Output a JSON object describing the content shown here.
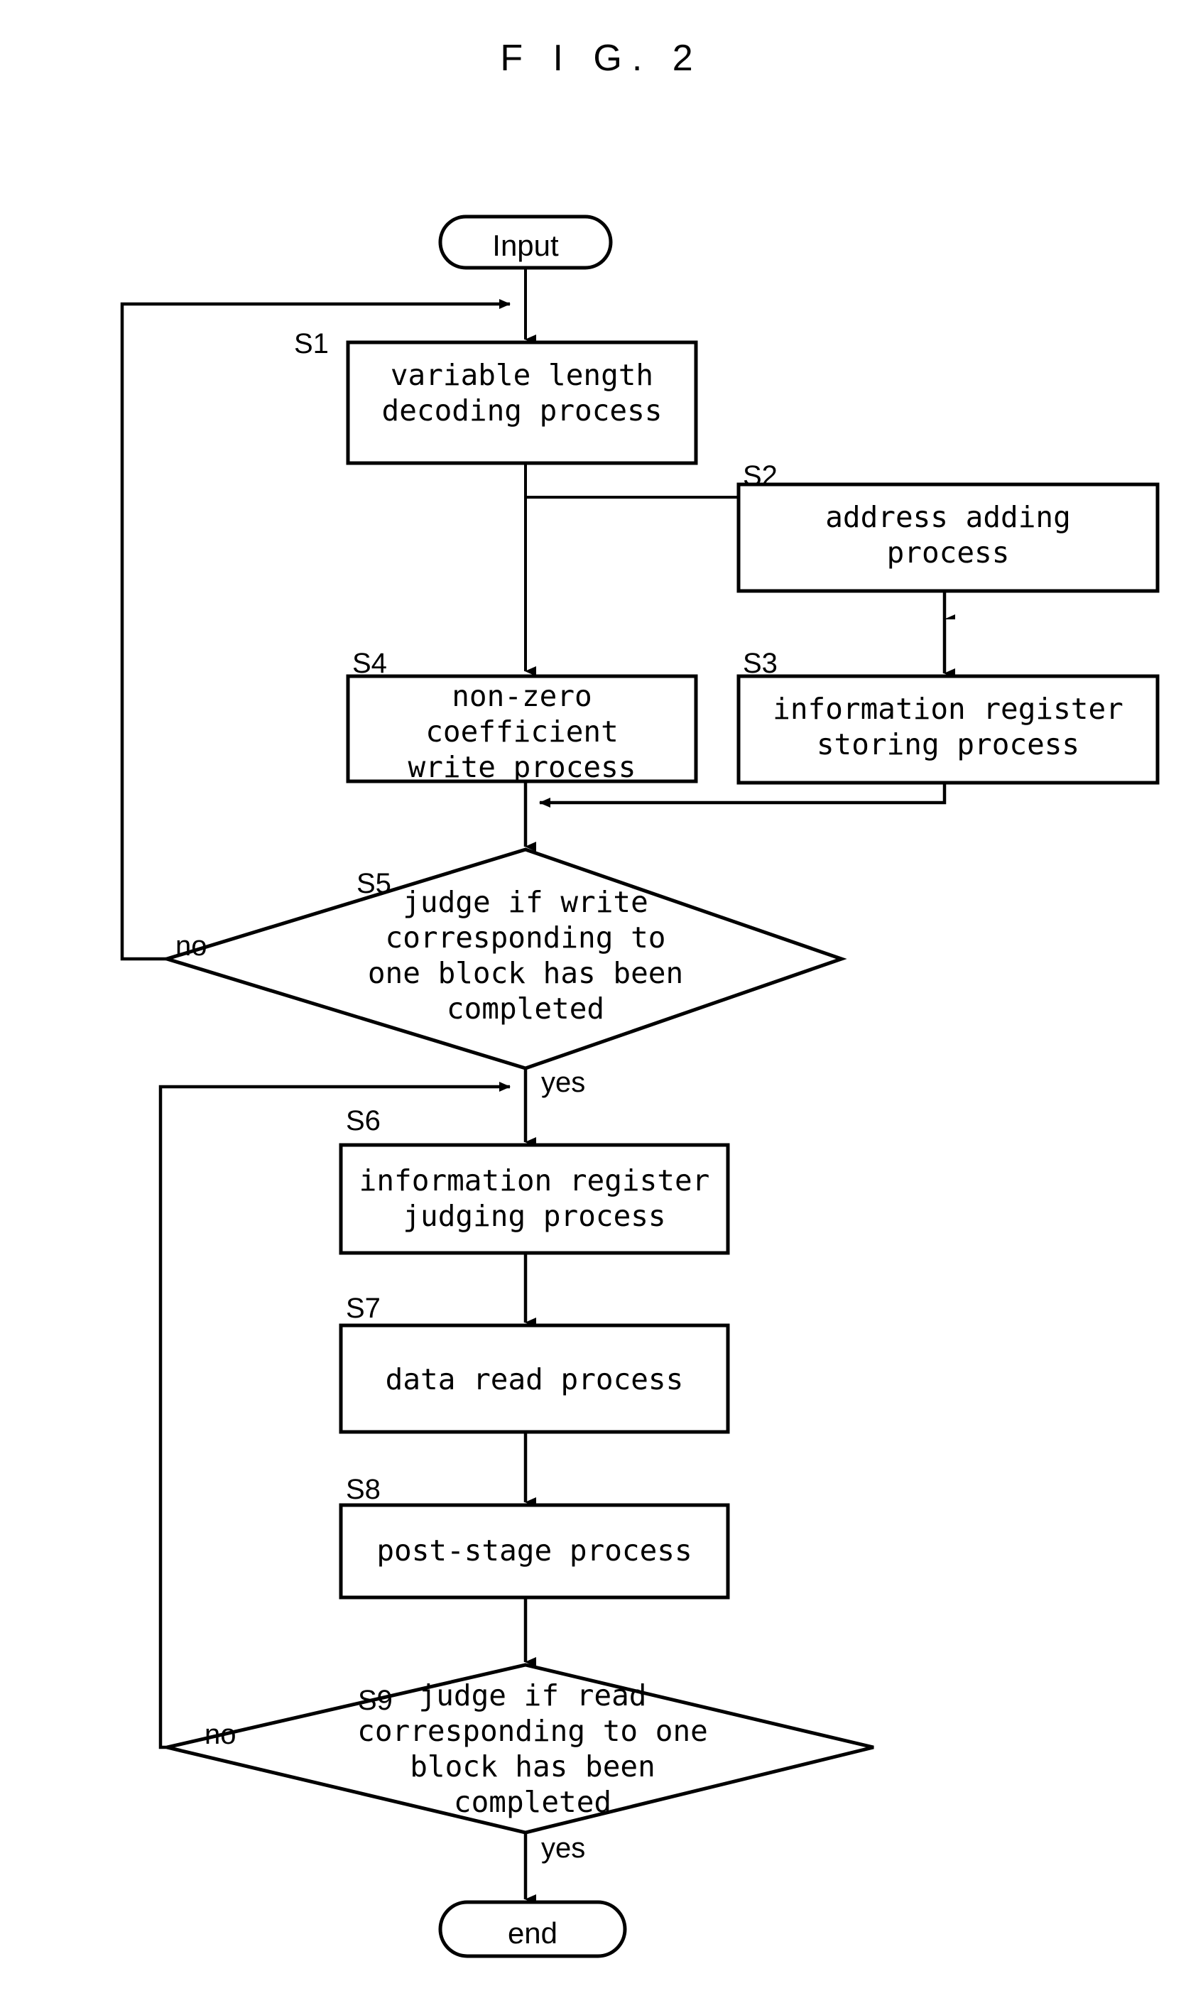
{
  "figure": {
    "title": "F I G. 2",
    "type": "flowchart"
  },
  "nodes": {
    "input": {
      "id": "Input",
      "shape": "terminal",
      "text": "Input"
    },
    "s1": {
      "id": "S1",
      "shape": "process",
      "text": "variable length\ndecoding process"
    },
    "s2": {
      "id": "S2",
      "shape": "process",
      "text": "address adding\nprocess"
    },
    "s3": {
      "id": "S3",
      "shape": "process",
      "text": "information register\nstoring process"
    },
    "s4": {
      "id": "S4",
      "shape": "process",
      "text": "non-zero\ncoefficient\nwrite process"
    },
    "s5": {
      "id": "S5",
      "shape": "decision",
      "text": "judge if write\ncorresponding to\none block has been\ncompleted"
    },
    "s6": {
      "id": "S6",
      "shape": "process",
      "text": "information register\njudging process"
    },
    "s7": {
      "id": "S7",
      "shape": "process",
      "text": "data read process"
    },
    "s8": {
      "id": "S8",
      "shape": "process",
      "text": "post-stage process"
    },
    "s9": {
      "id": "S9",
      "shape": "decision",
      "text": "judge if read\ncorresponding to one\nblock has been\ncompleted"
    },
    "end": {
      "id": "end",
      "shape": "terminal",
      "text": "end"
    }
  },
  "step_labels": {
    "s1": "S1",
    "s2": "S2",
    "s3": "S3",
    "s4": "S4",
    "s5": "S5",
    "s6": "S6",
    "s7": "S7",
    "s8": "S8",
    "s9": "S9"
  },
  "edge_labels": {
    "s5_no": "no",
    "s5_yes": "yes",
    "s9_no": "no",
    "s9_yes": "yes"
  },
  "edges": [
    {
      "from": "input",
      "to": "s1",
      "label": ""
    },
    {
      "from": "s1",
      "to": "s4",
      "label": ""
    },
    {
      "from": "s1",
      "to": "s2",
      "label": ""
    },
    {
      "from": "s2",
      "to": "s3",
      "label": ""
    },
    {
      "from": "s3",
      "to": "s5",
      "label": ""
    },
    {
      "from": "s4",
      "to": "s5",
      "label": ""
    },
    {
      "from": "s5",
      "to": "s1",
      "label": "no"
    },
    {
      "from": "s5",
      "to": "s6",
      "label": "yes"
    },
    {
      "from": "s6",
      "to": "s7",
      "label": ""
    },
    {
      "from": "s7",
      "to": "s8",
      "label": ""
    },
    {
      "from": "s8",
      "to": "s9",
      "label": ""
    },
    {
      "from": "s9",
      "to": "s6",
      "label": "no"
    },
    {
      "from": "s9",
      "to": "end",
      "label": "yes"
    }
  ],
  "style": {
    "stroke_color": "#000000",
    "background_color": "#ffffff",
    "stroke_width": "4"
  }
}
